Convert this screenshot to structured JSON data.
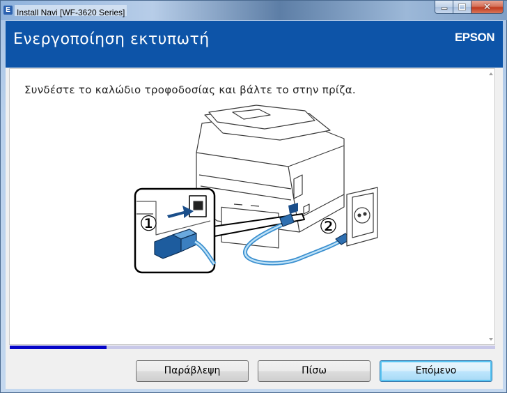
{
  "window": {
    "title": "Install Navi [WF-3620 Series]",
    "app_icon": "E"
  },
  "header": {
    "title": "Ενεργοποίηση εκτυπωτή",
    "brand": "EPSON",
    "background": "#0d54a8"
  },
  "content": {
    "instruction": "Συνδέστε το καλώδιο τροφοδοσίας και βάλτε το στην πρίζα.",
    "illustration": {
      "step1_label": "①",
      "step2_label": "②",
      "icons": [
        "printer",
        "power-cable",
        "wall-outlet",
        "arrow"
      ]
    }
  },
  "progress": {
    "fraction": 0.2,
    "fill_color": "#0505c8",
    "track_color": "#c8c8e8"
  },
  "buttons": {
    "skip": "Παράβλεψη",
    "back": "Πίσω",
    "next": "Επόμενο"
  }
}
